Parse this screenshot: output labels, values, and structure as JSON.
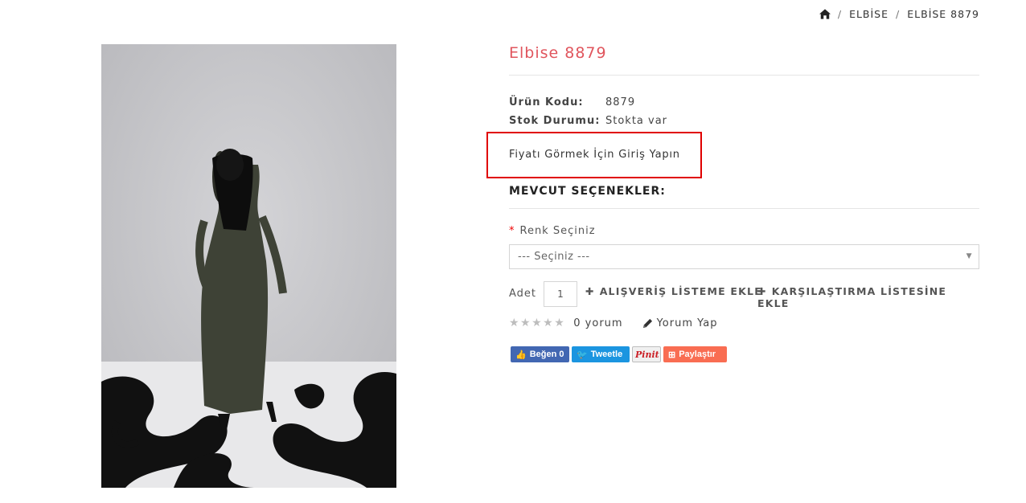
{
  "breadcrumb": {
    "home_icon": "home-icon",
    "items": [
      "ELBİSE",
      "ELBİSE 8879"
    ]
  },
  "product": {
    "title": "Elbise 8879",
    "title_color": "#e0555d",
    "code_label": "Ürün Kodu:",
    "code_value": "8879",
    "stock_label": "Stok Durumu:",
    "stock_value": "Stokta var",
    "price_login_text": "Fiyatı Görmek İçin Giriş Yapın",
    "highlight_color": "#e00000"
  },
  "options": {
    "title": "MEVCUT SEÇENEKLER:",
    "color_label": "Renk Seçiniz",
    "required_mark": "*",
    "select_value": "--- Seçiniz ---"
  },
  "cart": {
    "qty_label": "Adet",
    "qty_value": "1",
    "wishlist_label": "ALIŞVERİŞ LİSTEME EKLE",
    "compare_label": "KARŞILAŞTIRMA LİSTESİNE EKLE"
  },
  "reviews": {
    "rating": 0,
    "max_rating": 5,
    "count_text": "0 yorum",
    "write_label": "Yorum Yap"
  },
  "share": {
    "facebook_label": "Beğen 0",
    "twitter_label": "Tweetle",
    "pinterest_label": "Pinit",
    "share_label": "Paylaştır",
    "facebook_color": "#4267b2",
    "twitter_color": "#1b95e0",
    "share_color": "#f96d52"
  }
}
